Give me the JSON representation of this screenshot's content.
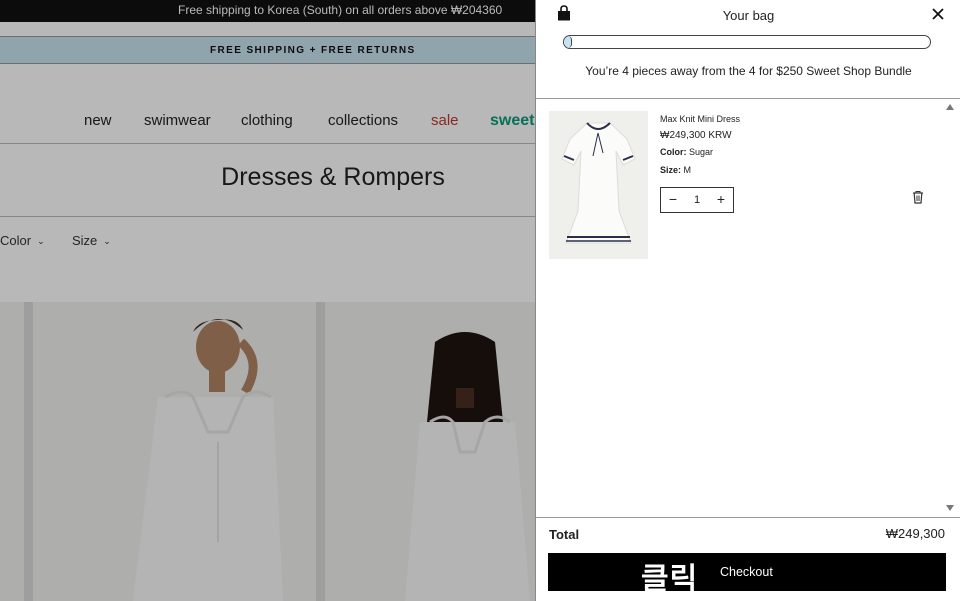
{
  "announcement": "Free shipping to Korea (South) on all orders above ₩204360",
  "promo": "FREE SHIPPING + FREE RETURNS",
  "nav": [
    "new",
    "swimwear",
    "clothing",
    "collections",
    "sale",
    "sweet"
  ],
  "page_title": "Dresses & Rompers",
  "filters": [
    "Color",
    "Size"
  ],
  "cart": {
    "title": "Your bag",
    "progress_fraction": 0.02,
    "progress_message": "You’re 4 pieces away from the 4 for $250 Sweet Shop Bundle",
    "item": {
      "name": "Max Knit Mini Dress",
      "price": "₩249,300 KRW",
      "color_label": "Color:",
      "color_value": "Sugar",
      "size_label": "Size:",
      "size_value": "M",
      "quantity": "1",
      "minus": "−",
      "plus": "+"
    },
    "total_label": "Total",
    "total_value": "₩249,300",
    "checkout_overlay": "클릭",
    "checkout_label": "Checkout"
  },
  "colors": {
    "promo_bg": "#c8e3f0",
    "sale": "#c0392b",
    "sweet": "#0a9b7c",
    "checkout_bg": "#000000"
  }
}
